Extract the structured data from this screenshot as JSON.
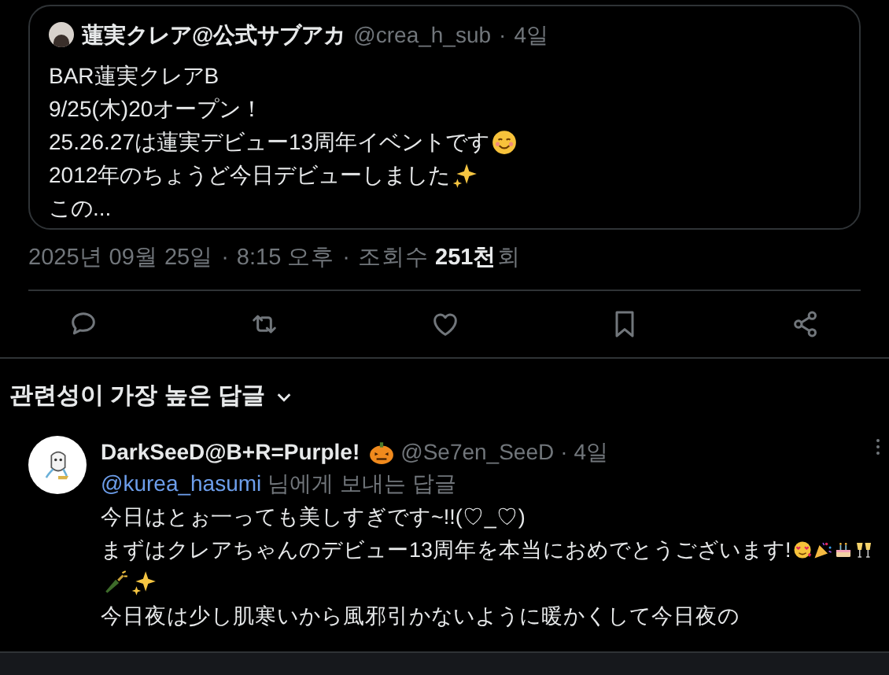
{
  "quoted_post": {
    "author_name": "蓮実クレア@公式サブアカ",
    "handle": "@crea_h_sub",
    "separator": "·",
    "age": "4일",
    "lines": [
      {
        "text": "BAR蓮実クレアB"
      },
      {
        "text": "9/25(木)20オープン！"
      },
      {
        "text": "25.26.27は蓮実デビュー13周年イベントです",
        "emoji": [
          {
            "kind": "smile"
          }
        ]
      },
      {
        "text": "2012年のちょうど今日デビューしました",
        "emoji": [
          {
            "kind": "sparkles"
          }
        ]
      },
      {
        "text": "この..."
      }
    ]
  },
  "meta": {
    "date": "2025년 09월 25일",
    "separator_1": "·",
    "time": "8:15 오후",
    "separator_2": "·",
    "views_label": "조회수",
    "views": "251천",
    "views_unit": "회"
  },
  "actions": [
    {
      "kind": "reply"
    },
    {
      "kind": "repost"
    },
    {
      "kind": "like"
    },
    {
      "kind": "bookmark"
    },
    {
      "kind": "share"
    }
  ],
  "sort": {
    "label": "관련성이 가장 높은 답글"
  },
  "reply": {
    "author_name": "DarkSeeD@B+R=Purple!",
    "name_emoji": [
      {
        "kind": "pumpkin"
      }
    ],
    "handle": "@Se7en_SeeD",
    "separator": "·",
    "age": "4일",
    "replying_to": "@kurea_hasumi",
    "replying_suffix": "님에게 보내는 답글",
    "lines": [
      {
        "text": "今日はとぉ一っても美しすぎです~!!(♡_♡)"
      },
      {
        "text": "まずはクレアちゃんのデビュー13周年を本当におめでとうございます!",
        "emoji": [
          {
            "kind": "hearts"
          },
          {
            "kind": "party"
          },
          {
            "kind": "cake"
          },
          {
            "kind": "glasses"
          }
        ]
      },
      {
        "emoji": [
          {
            "kind": "bottle"
          },
          {
            "kind": "sparkles"
          }
        ]
      },
      {
        "text": "今日夜は少し肌寒いから風邪引かないように暖かくして今日夜の"
      }
    ]
  }
}
